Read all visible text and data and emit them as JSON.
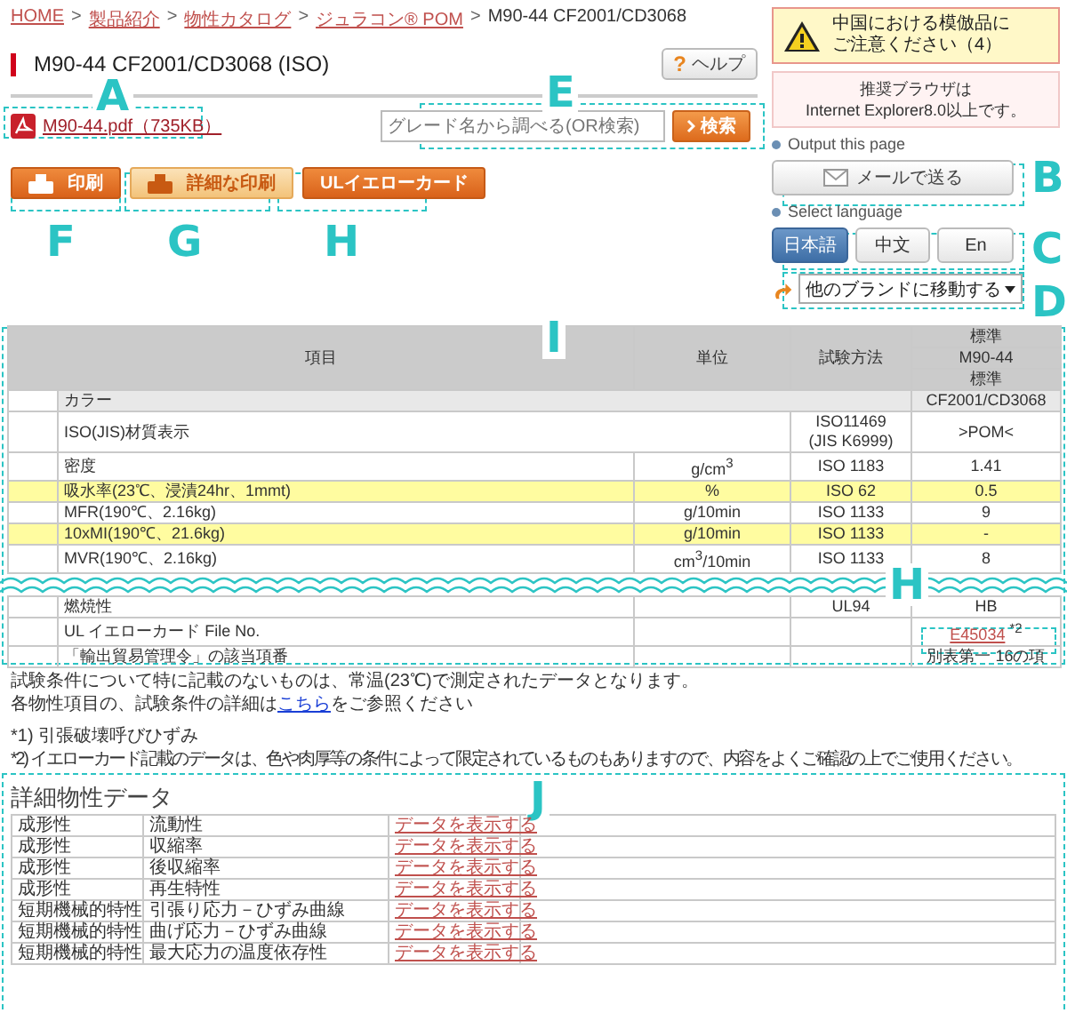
{
  "breadcrumb": [
    {
      "label": "HOME",
      "link": true
    },
    {
      "label": "製品紹介",
      "link": true
    },
    {
      "label": "物性カタログ",
      "link": true
    },
    {
      "label": "ジュラコン® POM",
      "link": true
    },
    {
      "label": "M90-44 CF2001/CD3068",
      "link": false
    }
  ],
  "breadcrumb_separator": ">",
  "title": "M90-44 CF2001/CD3068 (ISO)",
  "help_button": {
    "icon": "?",
    "label": "ヘルプ"
  },
  "pdf_link": "M90-44.pdf（735KB）",
  "search": {
    "placeholder": "グレード名から調べる(OR検索)",
    "button": "検索"
  },
  "actions": [
    {
      "label": "印刷",
      "kind": "print"
    },
    {
      "label": "詳細な印刷",
      "kind": "detail_print"
    },
    {
      "label": "ULイエローカード",
      "kind": "card"
    }
  ],
  "warning": [
    "中国における模倣品に",
    "ご注意ください（4）"
  ],
  "browser_notice": [
    "推奨ブラウザは",
    "Internet Explorer8.0以上です。"
  ],
  "output": {
    "heading": "Output this page",
    "button": "メールで送る"
  },
  "language": {
    "heading": "Select language",
    "options": [
      {
        "label": "日本語",
        "selected": true
      },
      {
        "label": "中文",
        "selected": false
      },
      {
        "label": "En",
        "selected": false
      }
    ]
  },
  "brand_select": "他のブランドに移動する",
  "table": {
    "header": {
      "item": "項目",
      "unit": "単位",
      "method": "試験方法",
      "grade": [
        "標準",
        "M90-44",
        "標準"
      ]
    },
    "rows": [
      {
        "kind": "span",
        "item": "カラー",
        "value": "CF2001/CD3068",
        "highlight": false
      },
      {
        "kind": "span2",
        "item": "ISO(JIS)材質表示",
        "method": "ISO11469",
        "method_2": "(JIS K6999)",
        "value": ">POM<",
        "highlight": false
      },
      {
        "kind": "normal",
        "item": "密度",
        "unit": "g/cm$^{3}$",
        "method": "ISO 1183",
        "value": "1.41",
        "highlight": false
      },
      {
        "kind": "normal",
        "item": "吸水率(23℃、浸漬24hr、1mmt)",
        "unit": "%",
        "method": "ISO 62",
        "value": "0.5",
        "highlight": true
      },
      {
        "kind": "normal",
        "item": "MFR(190℃、2.16kg)",
        "unit": "g/10min",
        "method": "ISO 1133",
        "value": "9",
        "highlight": false
      },
      {
        "kind": "normal",
        "item": "10xMI(190℃、21.6kg)",
        "unit": "g/10min",
        "method": "ISO 1133",
        "value": "-",
        "highlight": true
      },
      {
        "kind": "normal",
        "item": "MVR(190℃、2.16kg)",
        "unit": "cm$^{3}$/10min",
        "method": "ISO 1133",
        "value": "8",
        "highlight": false
      }
    ],
    "rows_after_break": [
      {
        "kind": "normal",
        "item": "燃焼性",
        "method": "UL94",
        "value": "HB",
        "highlight": false
      },
      {
        "kind": "link",
        "item": "UL イエローカード File No.",
        "value": "E45034",
        "note": "*2",
        "highlight": false
      },
      {
        "kind": "normal",
        "item": "「輸出貿易管理令」の該当項番",
        "value": "別表第一 16の項",
        "highlight": false
      }
    ]
  },
  "notes": {
    "line_1": "試験条件について特に記載のないものは、常温(23℃)で測定されたデータとなります。",
    "line_2_before": "各物性項目の、試験条件の詳細は",
    "line_2_link": "こちら",
    "line_2_after": "をご参照ください",
    "footnotes": [
      "*1) 引張破壊呼びひずみ",
      "*2) イエローカード記載のデータは、色や肉厚等の条件によって限定されているものもありますので、内容をよくご確認の上でご使用ください。"
    ]
  },
  "details": {
    "heading": "詳細物性データ",
    "rows": [
      {
        "category": "成形性",
        "property": "流動性",
        "link": "データを表示する"
      },
      {
        "category": "成形性",
        "property": "収縮率",
        "link": "データを表示する"
      },
      {
        "category": "成形性",
        "property": "後収縮率",
        "link": "データを表示する"
      },
      {
        "category": "成形性",
        "property": "再生特性",
        "link": "データを表示する"
      },
      {
        "category": "短期機械的特性",
        "property": "引張り応力－ひずみ曲線",
        "link": "データを表示する"
      },
      {
        "category": "短期機械的特性",
        "property": "曲げ応力－ひずみ曲線",
        "link": "データを表示する"
      },
      {
        "category": "短期機械的特性",
        "property": "最大応力の温度依存性",
        "link": "データを表示する"
      }
    ]
  },
  "callouts": [
    {
      "label": "A"
    },
    {
      "label": "E"
    },
    {
      "label": "B"
    },
    {
      "label": "C"
    },
    {
      "label": "D"
    },
    {
      "label": "F"
    },
    {
      "label": "G"
    },
    {
      "label": "H"
    },
    {
      "label": "I"
    },
    {
      "label": "H"
    },
    {
      "label": "J"
    }
  ]
}
